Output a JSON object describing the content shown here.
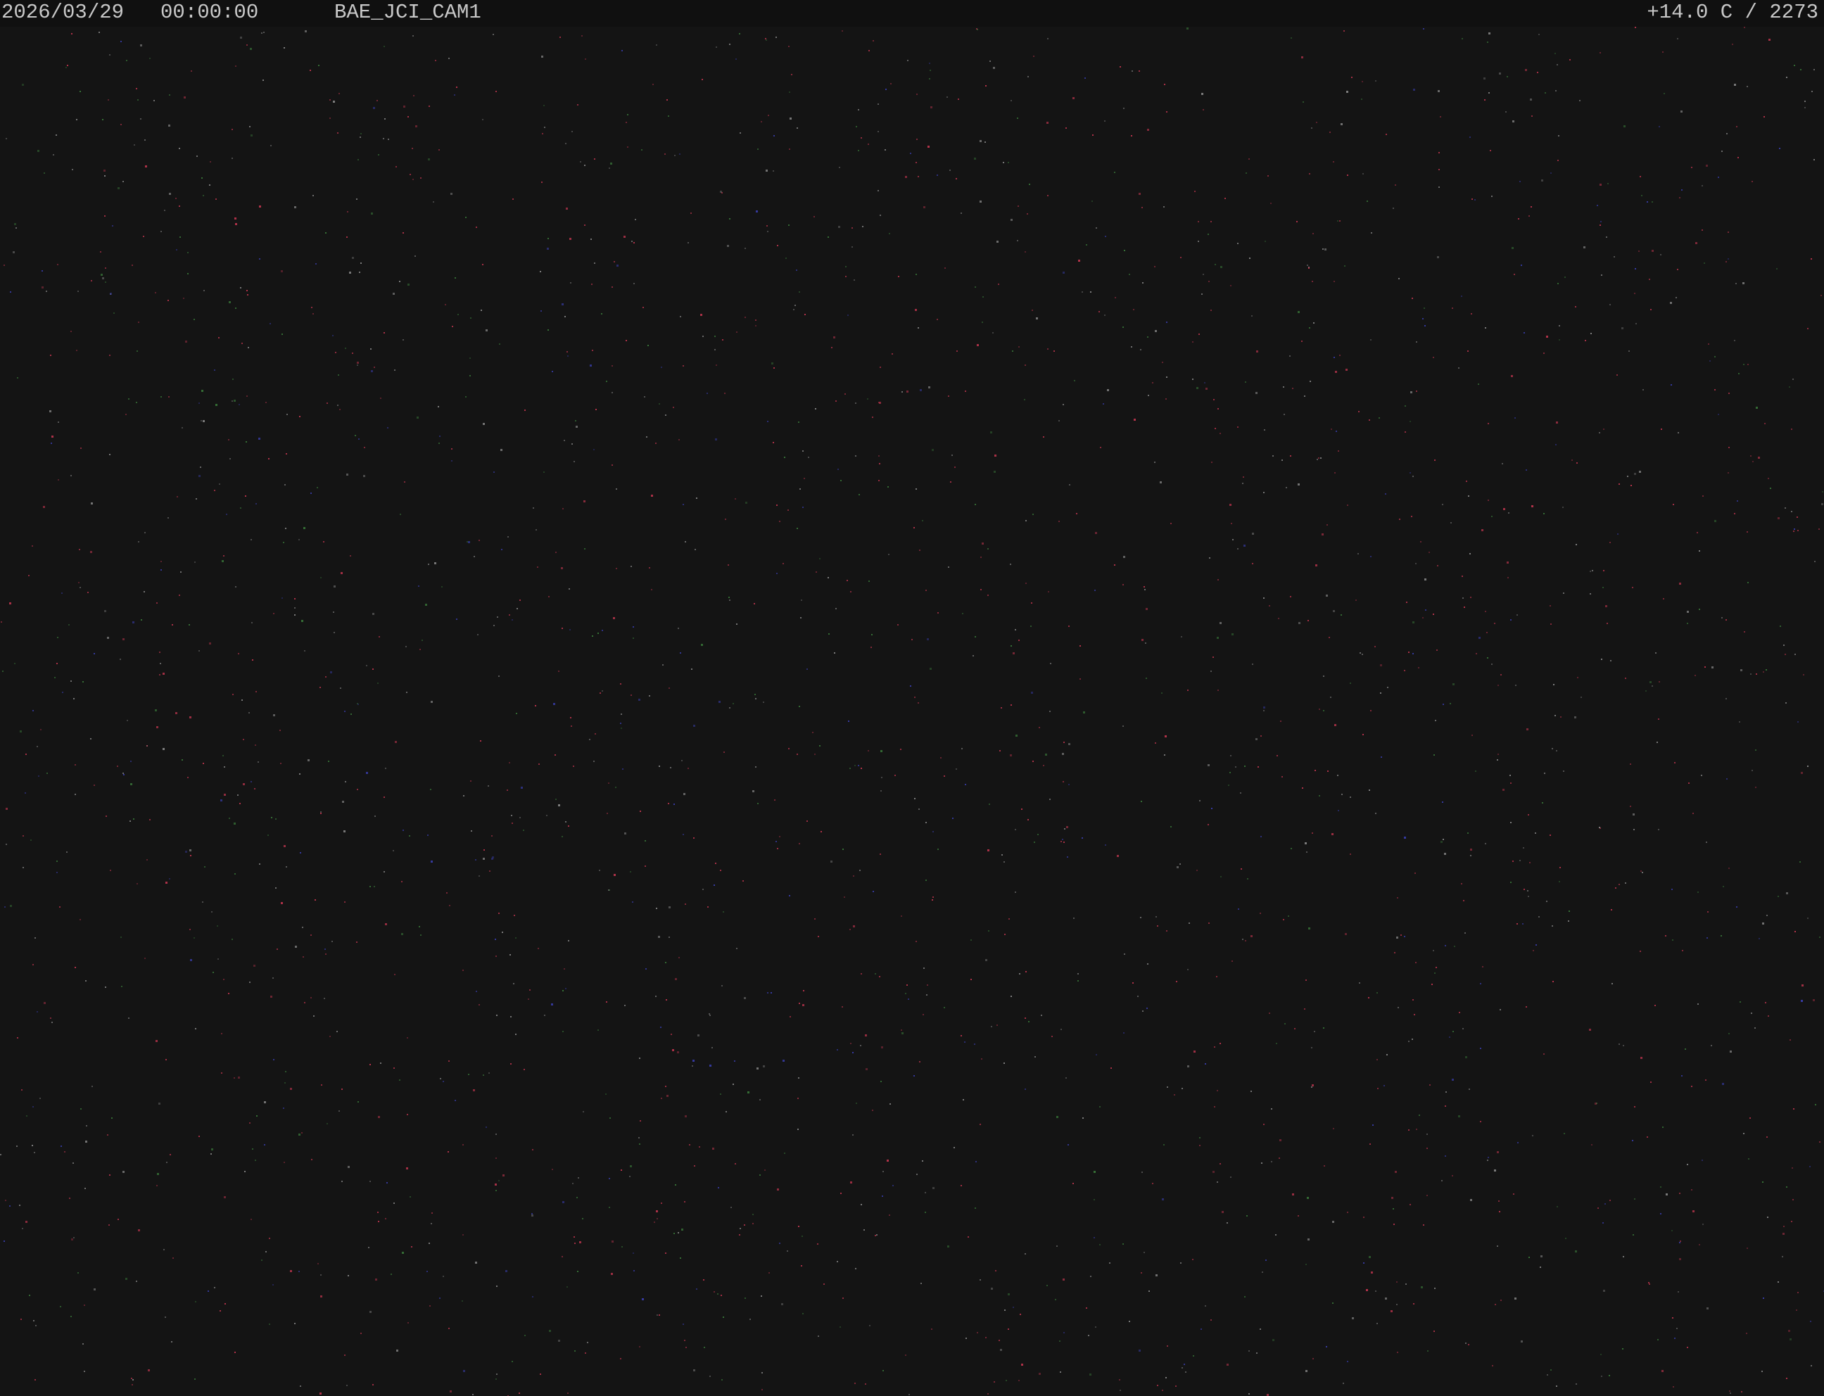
{
  "overlay": {
    "date": "2026/03/29",
    "time": "00:00:00",
    "camera_name": "BAE_JCI_CAM1",
    "status": "+14.0 C / 2273"
  },
  "image": {
    "description_type": "night-sky-camera-frame",
    "background_color": "#141414",
    "noise_colors": [
      "#c2364f",
      "#3a3fb0",
      "#3a7a3a",
      "#8a8a8a"
    ]
  }
}
